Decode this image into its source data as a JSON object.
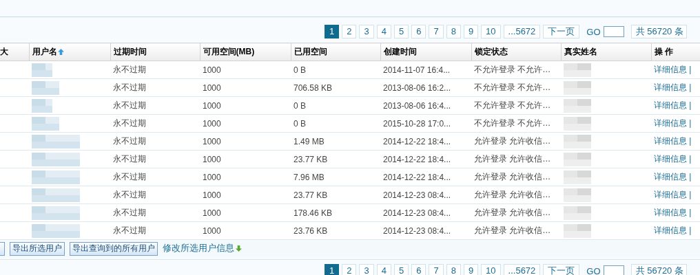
{
  "pagination_top": {
    "pages": [
      {
        "label": "1",
        "selected": true
      },
      {
        "label": "2",
        "selected": false
      },
      {
        "label": "3",
        "selected": false
      },
      {
        "label": "4",
        "selected": false
      },
      {
        "label": "5",
        "selected": false
      },
      {
        "label": "6",
        "selected": false
      },
      {
        "label": "7",
        "selected": false
      },
      {
        "label": "8",
        "selected": false
      },
      {
        "label": "9",
        "selected": false
      },
      {
        "label": "10",
        "selected": false
      },
      {
        "label": "...5672",
        "selected": false
      }
    ],
    "next": "下一页",
    "go_label": "GO",
    "total": "共 56720 条"
  },
  "table": {
    "columns": [
      {
        "label": "大",
        "sorted": false
      },
      {
        "label": "用户名",
        "sorted": true
      },
      {
        "label": "过期时间",
        "sorted": false
      },
      {
        "label": "可用空间(MB)",
        "sorted": false
      },
      {
        "label": "已用空间",
        "sorted": false
      },
      {
        "label": "创建时间",
        "sorted": false
      },
      {
        "label": "锁定状态",
        "sorted": false
      },
      {
        "label": "真实姓名",
        "sorted": false
      },
      {
        "label": "操 作",
        "sorted": false
      }
    ],
    "rows": [
      {
        "expires": "永不过期",
        "available": "1000",
        "used": "0 B",
        "created": "2014-11-07 16:4...",
        "lock": "不允许登录 不允许…",
        "action": "详细信息 |"
      },
      {
        "expires": "永不过期",
        "available": "1000",
        "used": "706.58 KB",
        "created": "2013-08-06 16:2...",
        "lock": "不允许登录 不允许…",
        "action": "详细信息 |"
      },
      {
        "expires": "永不过期",
        "available": "1000",
        "used": "0 B",
        "created": "2013-08-06 16:4...",
        "lock": "不允许登录 不允许…",
        "action": "详细信息 |"
      },
      {
        "expires": "永不过期",
        "available": "1000",
        "used": "0 B",
        "created": "2015-10-28 17:0...",
        "lock": "不允许登录 不允许…",
        "action": "详细信息 |"
      },
      {
        "expires": "永不过期",
        "available": "1000",
        "used": "1.49 MB",
        "created": "2014-12-22 18:4...",
        "lock": "允许登录 允许收信…",
        "action": "详细信息 |"
      },
      {
        "expires": "永不过期",
        "available": "1000",
        "used": "23.77 KB",
        "created": "2014-12-22 18:4...",
        "lock": "允许登录 允许收信…",
        "action": "详细信息 |"
      },
      {
        "expires": "永不过期",
        "available": "1000",
        "used": "7.96 MB",
        "created": "2014-12-22 18:4...",
        "lock": "允许登录 允许收信…",
        "action": "详细信息 |"
      },
      {
        "expires": "永不过期",
        "available": "1000",
        "used": "23.77 KB",
        "created": "2014-12-23 08:4...",
        "lock": "允许登录 允许收信…",
        "action": "详细信息 |"
      },
      {
        "expires": "永不过期",
        "available": "1000",
        "used": "178.46 KB",
        "created": "2014-12-23 08:4...",
        "lock": "允许登录 允许收信…",
        "action": "详细信息 |"
      },
      {
        "expires": "永不过期",
        "available": "1000",
        "used": "23.76 KB",
        "created": "2014-12-23 08:4...",
        "lock": "允许登录 允许收信…",
        "action": "详细信息 |"
      }
    ]
  },
  "actions": {
    "buttons": [
      "导出所选用户",
      "导出查询到的所有用户"
    ],
    "link": "修改所选用户信息"
  },
  "pagination_bottom": {
    "pages": [
      {
        "label": "1",
        "selected": true
      },
      {
        "label": "2",
        "selected": false
      },
      {
        "label": "3",
        "selected": false
      },
      {
        "label": "4",
        "selected": false
      },
      {
        "label": "5",
        "selected": false
      },
      {
        "label": "6",
        "selected": false
      },
      {
        "label": "7",
        "selected": false
      },
      {
        "label": "8",
        "selected": false
      },
      {
        "label": "9",
        "selected": false
      },
      {
        "label": "10",
        "selected": false
      },
      {
        "label": "...5672",
        "selected": false
      }
    ],
    "next": "下一页",
    "go_label": "GO",
    "total": "共 56720 条"
  }
}
